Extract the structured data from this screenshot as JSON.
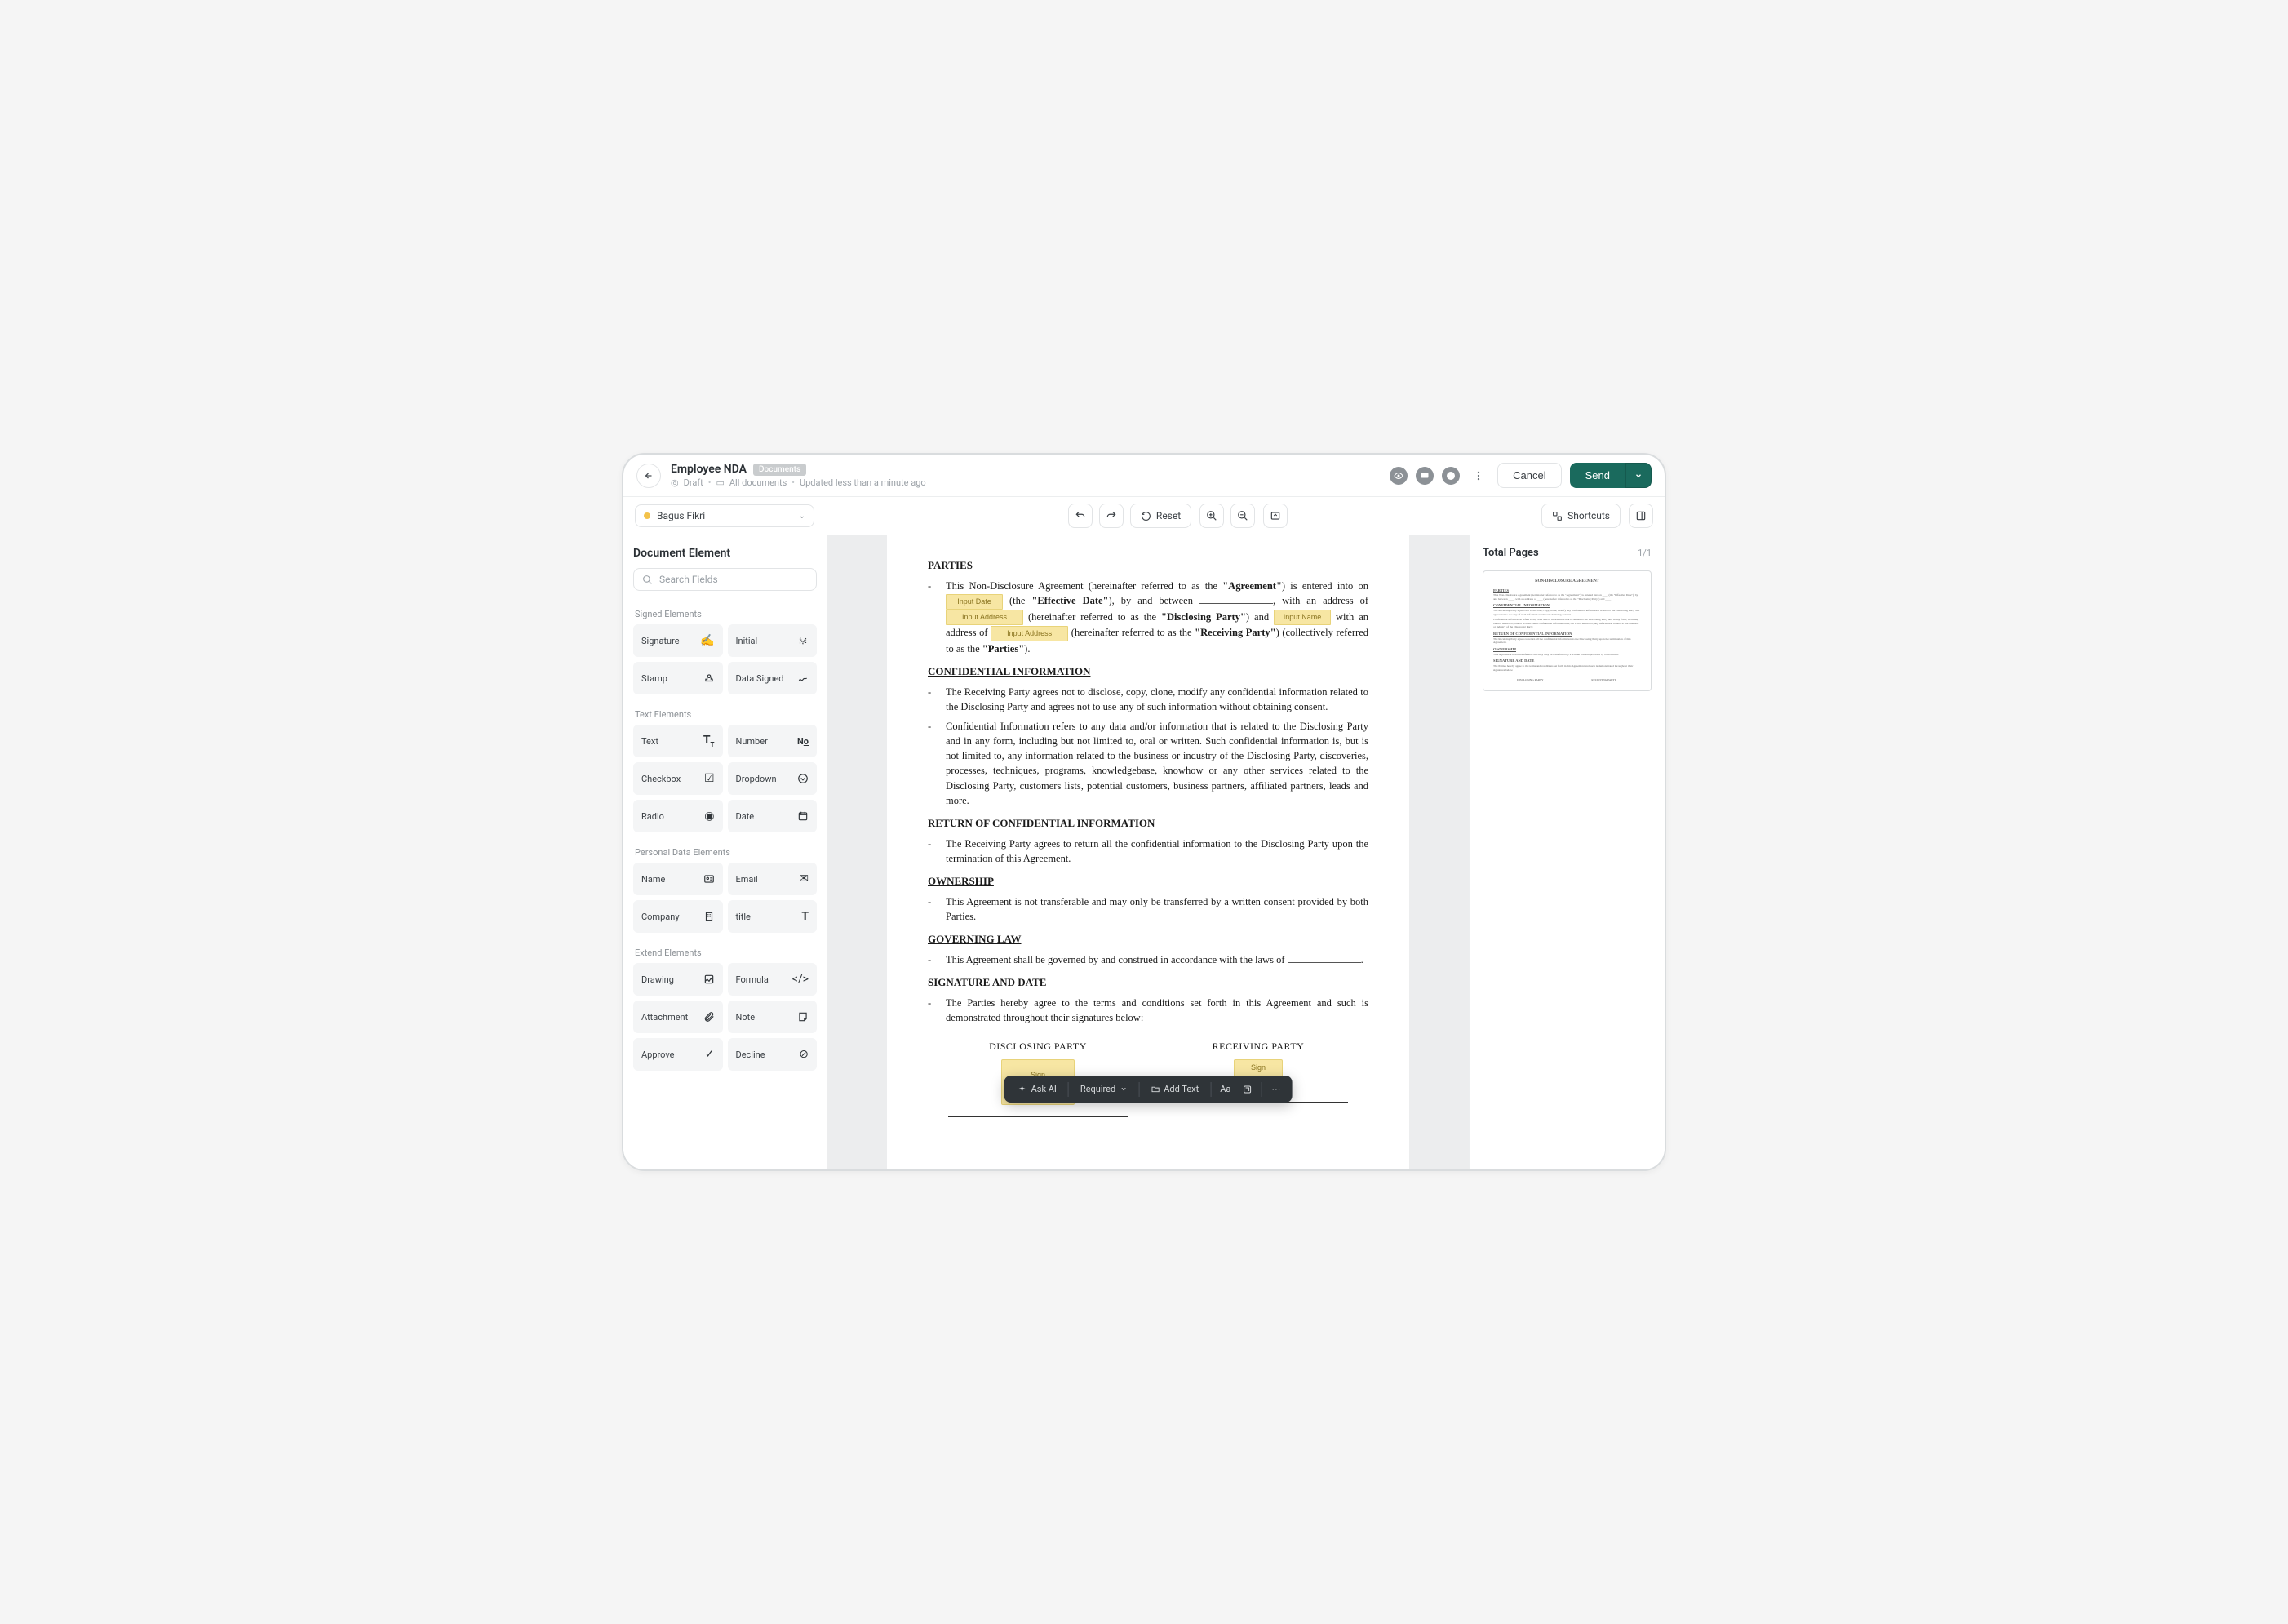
{
  "header": {
    "title": "Employee NDA",
    "chip": "Documents",
    "status": "Draft",
    "collection": "All documents",
    "updated": "Updated less than a minute ago",
    "cancel": "Cancel",
    "send": "Send"
  },
  "recipient": {
    "name": "Bagus Fikri"
  },
  "toolbar": {
    "reset": "Reset",
    "shortcuts": "Shortcuts"
  },
  "leftPanel": {
    "title": "Document Element",
    "searchPlaceholder": "Search Fields",
    "sections": {
      "signed": "Signed Elements",
      "text": "Text Elements",
      "personal": "Personal Data Elements",
      "extend": "Extend Elements"
    },
    "items": {
      "signature": "Signature",
      "initial": "Initial",
      "stamp": "Stamp",
      "dataSigned": "Data Signed",
      "text": "Text",
      "number": "Number",
      "checkbox": "Checkbox",
      "dropdown": "Dropdown",
      "radio": "Radio",
      "date": "Date",
      "name": "Name",
      "email": "Email",
      "company": "Company",
      "title": "title",
      "drawing": "Drawing",
      "formula": "Formula",
      "attachment": "Attachment",
      "note": "Note",
      "approve": "Approve",
      "decline": "Decline"
    }
  },
  "doc": {
    "h_parties": "PARTIES",
    "parties_intro_a": "This Non-Disclosure Agreement (hereinafter referred to as the ",
    "parties_agreement": "\"Agreement\"",
    "parties_intro_b": ") is entered into on ",
    "parties_the": " (the ",
    "parties_effdate": "\"Effective Date\"",
    "parties_byand": "), by and between ",
    "parties_addr1": ", with an address of ",
    "parties_ref1": " (hereinafter referred to as the ",
    "parties_disc": "\"Disclosing Party\"",
    "parties_and": ") and ",
    "parties_addr2": " with an address of ",
    "parties_ref2": " (hereinafter referred to as the ",
    "parties_recv": "\"Receiving Party\"",
    "parties_coll": ") (collectively referred to as the ",
    "parties_parties": "\"Parties\"",
    "parties_end": ").",
    "h_conf": "CONFIDENTIAL INFORMATION",
    "conf_p1": "The Receiving Party agrees not to disclose, copy, clone, modify any confidential information related to the Disclosing Party and agrees not to use any of such information without obtaining consent.",
    "conf_p2": "Confidential Information refers to any data and/or information that is related to the Disclosing Party and in any form, including but not limited to, oral or written. Such confidential information is, but is not limited to, any information related to the business or industry of the Disclosing Party, discoveries, processes, techniques, programs, knowledgebase, knowhow or any other services related to the Disclosing Party, customers lists, potential customers, business partners, affiliated partners, leads and more.",
    "h_return": "RETURN OF CONFIDENTIAL INFORMATION",
    "return_p": "The Receiving Party agrees to return all the confidential information to the Disclosing Party upon the termination of this Agreement.",
    "h_own": "OWNERSHIP",
    "own_p": "This Agreement is not transferable and may only be transferred by a written consent provided by both Parties.",
    "h_gov": "GOVERNING LAW",
    "gov_p_a": "This Agreement shall be governed by and construed in accordance with the laws of ",
    "gov_p_b": ".",
    "h_sig": "SIGNATURE AND DATE",
    "sig_p": "The Parties hereby agree to the terms and conditions set forth in this Agreement and such is demonstrated throughout their signatures below:",
    "disclosing": "DISCLOSING PARTY",
    "receiving": "RECEIVING PARTY",
    "fields": {
      "inputDate": "Input Date",
      "inputAddress": "Input Address",
      "inputName": "Input Name",
      "sign": "Sign"
    }
  },
  "floatToolbar": {
    "askAi": "Ask AI",
    "required": "Required",
    "addText": "Add Text"
  },
  "rightPanel": {
    "title": "Total Pages",
    "count": "1/1"
  }
}
